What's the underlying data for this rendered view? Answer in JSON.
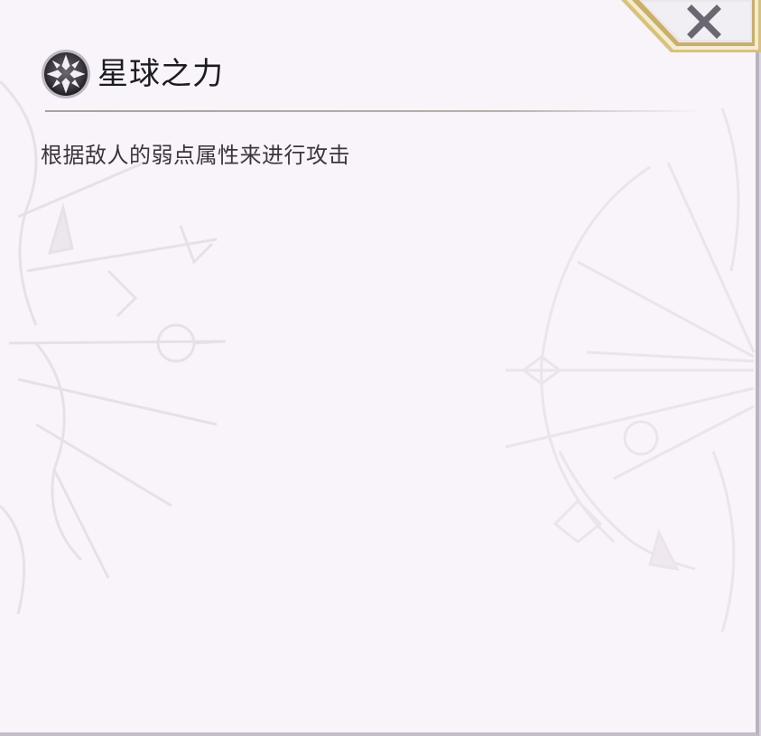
{
  "skill": {
    "title": "星球之力",
    "description": "根据敌人的弱点属性来进行攻击"
  },
  "icons": {
    "skill_icon": "star-orb-icon",
    "close_icon": "close-x-icon"
  },
  "colors": {
    "panel_background": "#f8f4f9",
    "title_text": "#1e1a22",
    "description_text": "#3a363c",
    "close_frame_gold": "#d8c27a",
    "close_x": "#6b6670"
  }
}
